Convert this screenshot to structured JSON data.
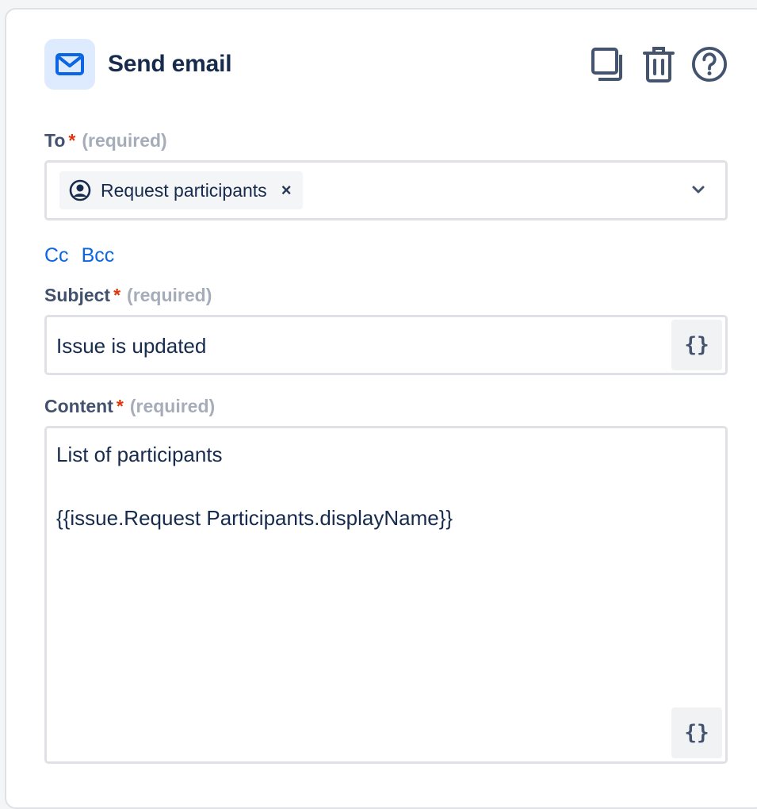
{
  "header": {
    "title": "Send email",
    "icon": "mail-icon",
    "actions": [
      "duplicate-icon",
      "trash-icon",
      "help-icon"
    ]
  },
  "to": {
    "label": "To",
    "required_mark": "*",
    "required_text": "(required)",
    "chip_label": "Request participants",
    "chip_remove": "×"
  },
  "recipients_links": {
    "cc": "Cc",
    "bcc": "Bcc"
  },
  "subject": {
    "label": "Subject",
    "required_mark": "*",
    "required_text": "(required)",
    "value": "Issue is updated",
    "smart_value_button": "{}"
  },
  "content": {
    "label": "Content",
    "required_mark": "*",
    "required_text": "(required)",
    "line1": "List of participants",
    "line2": "{{issue.Request Participants.displayName}}",
    "smart_value_button": "{}"
  },
  "colors": {
    "accent": "#0c66e4",
    "required": "#de350b",
    "text": "#172b4d"
  }
}
